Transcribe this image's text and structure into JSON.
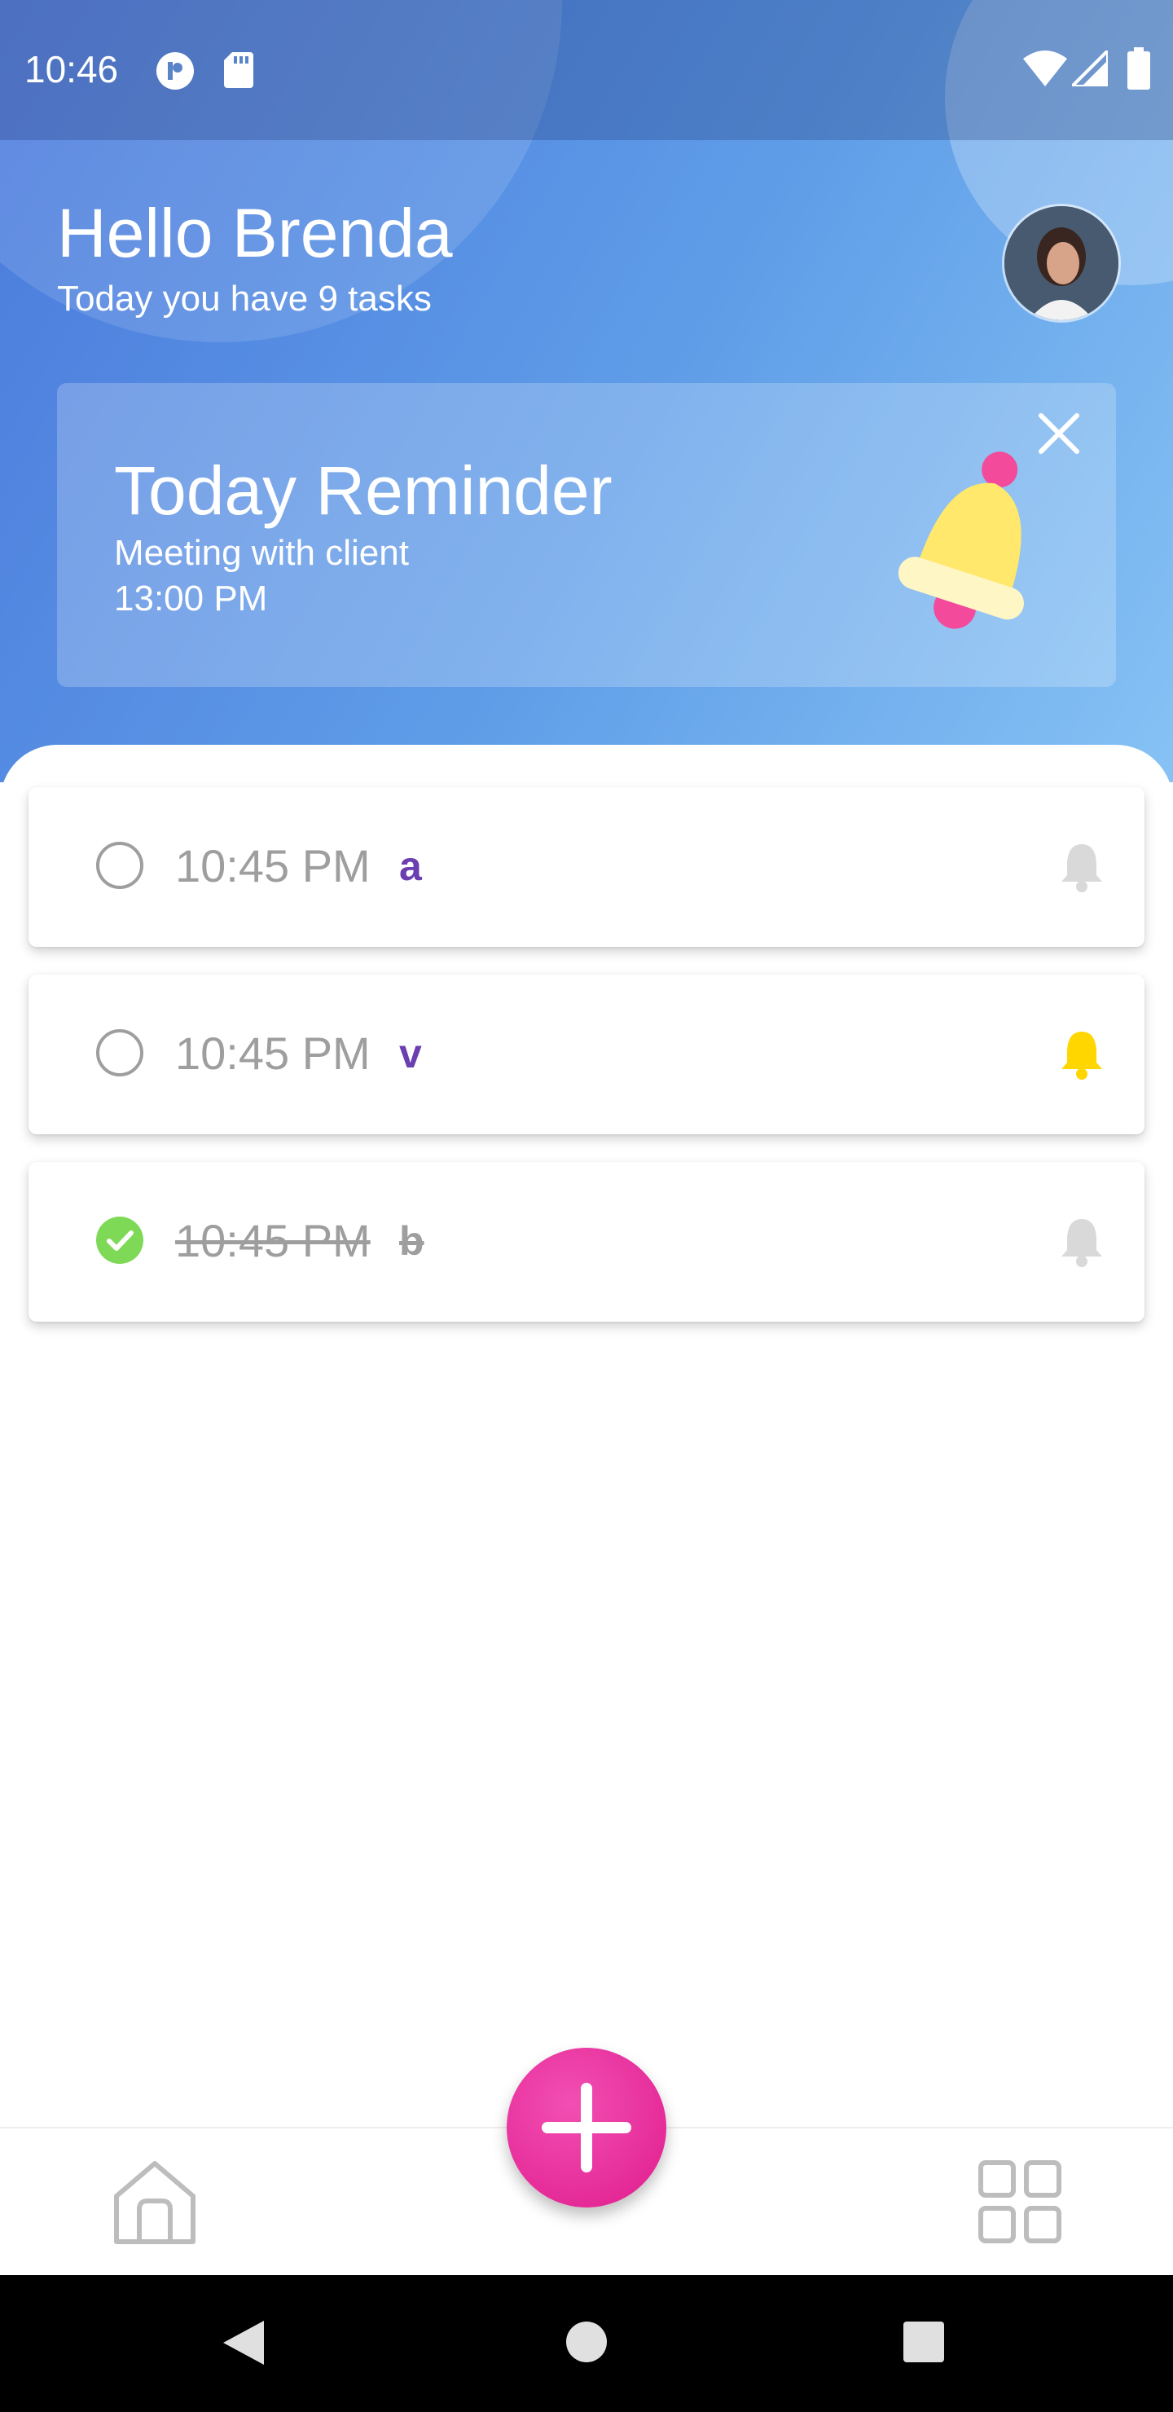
{
  "status_bar": {
    "time": "10:46",
    "left_icons": [
      "app-notification-icon",
      "sd-card-icon"
    ],
    "right_icons": [
      "wifi-icon",
      "cell-signal-icon",
      "battery-icon"
    ]
  },
  "header": {
    "greeting": "Hello Brenda",
    "subtitle": "Today you have 9 tasks"
  },
  "reminder": {
    "title": "Today Reminder",
    "description": "Meeting with client",
    "time": "13:00 PM",
    "icons": [
      "bell-illustration",
      "close-icon"
    ]
  },
  "tasks": [
    {
      "time": "10:45 PM",
      "title": "a",
      "completed": false,
      "alarm": false
    },
    {
      "time": "10:45 PM",
      "title": "v",
      "completed": false,
      "alarm": true
    },
    {
      "time": "10:45 PM",
      "title": "b",
      "completed": true,
      "alarm": false
    }
  ],
  "colors": {
    "header_gradient_start": "#4a79dc",
    "header_gradient_end": "#86c2f4",
    "task_title": "#6a3fb1",
    "alarm_on": "#ffd600",
    "alarm_off": "#d9d9d9",
    "completed_check": "#7ed957",
    "fab": "#e61f93"
  },
  "bottom_nav": {
    "items": [
      "home-icon",
      "add-button",
      "grid-icon"
    ]
  }
}
